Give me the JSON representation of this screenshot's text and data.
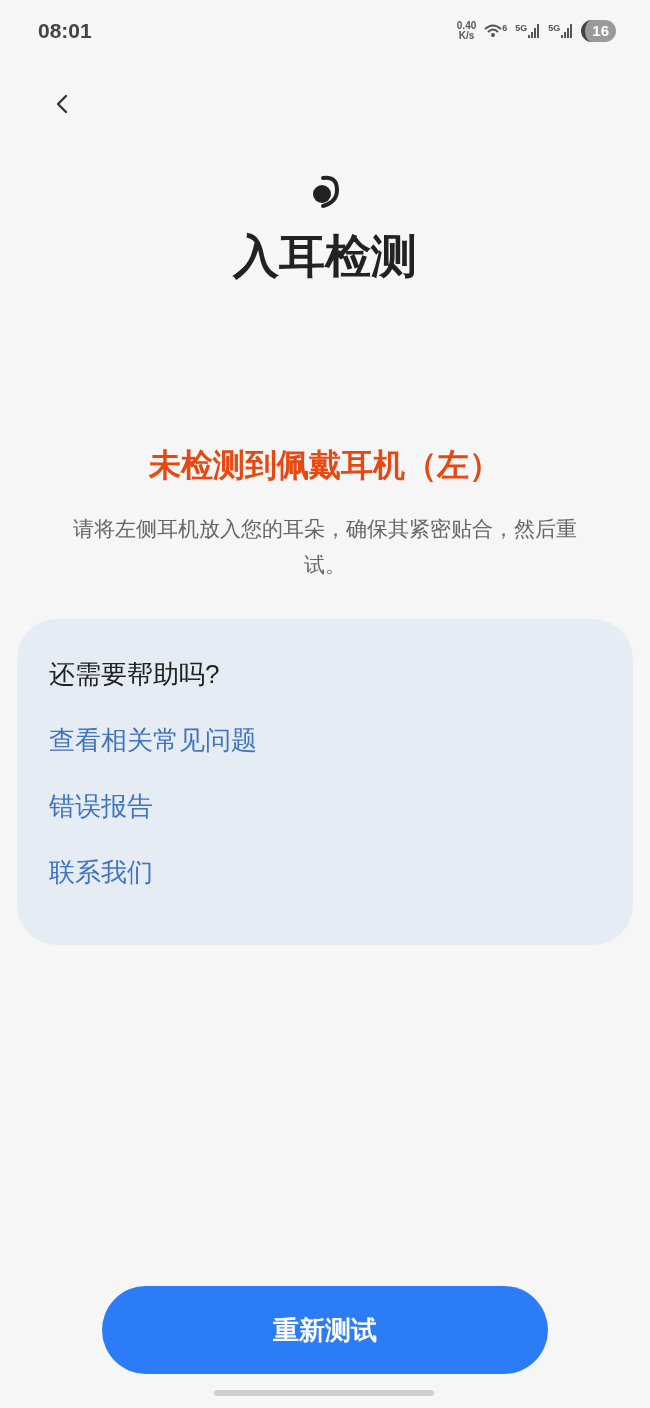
{
  "status_bar": {
    "time": "08:01",
    "speed_value": "0.40",
    "speed_unit": "K/s",
    "wifi_label": "6",
    "sim_labels": [
      "5G",
      "5G"
    ],
    "battery": "16"
  },
  "title": "入耳检测",
  "error": "未检测到佩戴耳机（左）",
  "instruction": "请将左侧耳机放入您的耳朵，确保其紧密贴合，然后重试。",
  "help": {
    "heading": "还需要帮助吗?",
    "links": [
      "查看相关常见问题",
      "错误报告",
      "联系我们"
    ]
  },
  "button": "重新测试"
}
